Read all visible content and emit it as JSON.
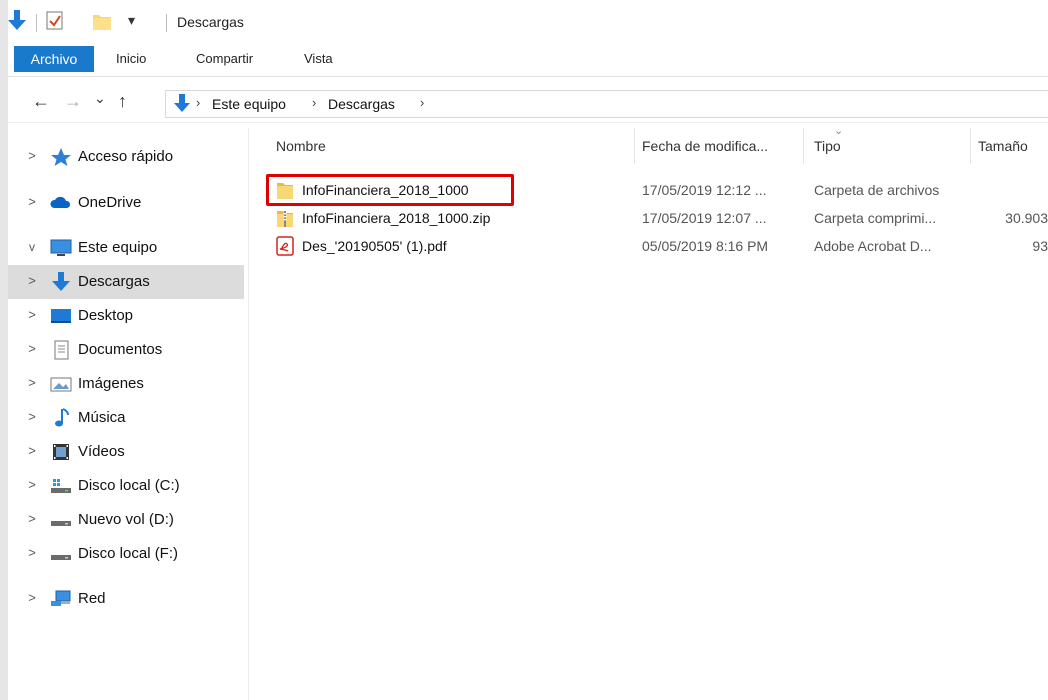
{
  "window": {
    "title": "Descargas",
    "qat_dropdown": "▾"
  },
  "ribbon": {
    "tabs": [
      "Archivo",
      "Inicio",
      "Compartir",
      "Vista"
    ]
  },
  "addressbar": {
    "back": "←",
    "forward": "→",
    "recent": "⌄",
    "up": "↑",
    "crumbs": [
      "Este equipo",
      "Descargas"
    ],
    "separator": "›"
  },
  "nav": {
    "items": [
      {
        "label": "Acceso rápido",
        "icon": "star-icon",
        "expanded": false
      },
      {
        "label": "OneDrive",
        "icon": "cloud-icon",
        "expanded": false
      },
      {
        "label": "Este equipo",
        "icon": "computer-icon",
        "expanded": true
      },
      {
        "label": "Descargas",
        "icon": "download-arrow-icon",
        "selected": true
      },
      {
        "label": "Desktop",
        "icon": "desktop-icon"
      },
      {
        "label": "Documentos",
        "icon": "document-icon"
      },
      {
        "label": "Imágenes",
        "icon": "pictures-icon"
      },
      {
        "label": "Música",
        "icon": "music-icon"
      },
      {
        "label": "Vídeos",
        "icon": "video-icon"
      },
      {
        "label": "Disco local (C:)",
        "icon": "windows-drive-icon"
      },
      {
        "label": "Nuevo vol (D:)",
        "icon": "drive-icon"
      },
      {
        "label": "Disco local (F:)",
        "icon": "drive-icon"
      },
      {
        "label": "Red",
        "icon": "network-icon"
      }
    ]
  },
  "files": {
    "columns": [
      "Nombre",
      "Fecha de modifica...",
      "Tipo",
      "Tamaño"
    ],
    "rows": [
      {
        "name": "InfoFinanciera_2018_1000",
        "date": "17/05/2019 12:12 ...",
        "type": "Carpeta de archivos",
        "size": "",
        "icon": "folder-icon"
      },
      {
        "name": "InfoFinanciera_2018_1000.zip",
        "date": "17/05/2019 12:07 ...",
        "type": "Carpeta comprimi...",
        "size": "30.903",
        "icon": "zip-folder-icon"
      },
      {
        "name": "Des_'20190505' (1).pdf",
        "date": "05/05/2019 8:16 PM",
        "type": "Adobe Acrobat D...",
        "size": "93",
        "icon": "pdf-icon"
      }
    ]
  },
  "colors": {
    "accent": "#1979ca",
    "selection": "#dcdcdc",
    "highlight": "#e00000",
    "folder": "#f8d775"
  }
}
